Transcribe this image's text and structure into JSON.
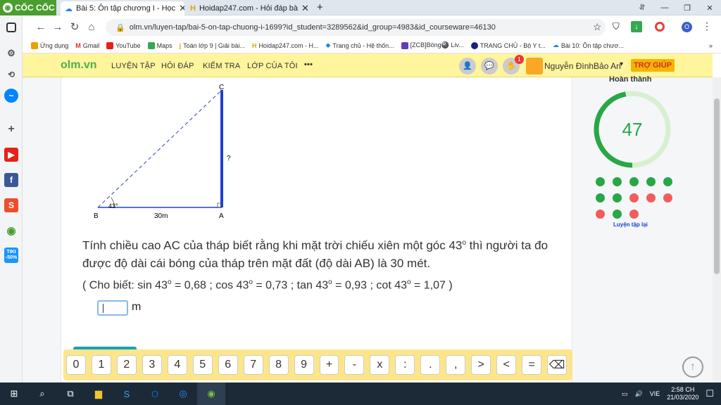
{
  "browser": {
    "brand": "CỐC CỐC",
    "tabs": [
      {
        "title": "Bài 5: Ôn tập chương I - Học",
        "active": true
      },
      {
        "title": "Hoidap247.com - Hỏi đáp bà",
        "active": false
      }
    ],
    "url": "olm.vn/luyen-tap/bai-5-on-tap-chuong-i-1699?id_student=3289562&id_group=4983&id_courseware=46130",
    "bookmarks": [
      "Ứng dụng",
      "Gmail",
      "YouTube",
      "Maps",
      "Toán lớp 9 | Giải bài...",
      "Hoidap247.com - H...",
      "Trang chủ - Hệ thốn...",
      "[ZCB]Bóng🎱 Liv...",
      "TRANG CHỦ - Bộ Y t...",
      "Bài 10: Ôn tập chươ..."
    ]
  },
  "sidebar_badge": "TIKI -50%",
  "olm": {
    "logo": "olm.vn",
    "nav": [
      "LUYỆN TẬP",
      "HỎI ĐÁP",
      "KIỂM TRA",
      "LỚP CỦA TÔI",
      "•••"
    ],
    "notif_count": "1",
    "user": "Nguyễn ĐìnhBảo An",
    "help": "TRỢ GIÚP"
  },
  "figure": {
    "labels": {
      "c": "C",
      "b": "B",
      "a": "A",
      "q": "?",
      "angle": "43°",
      "base": "30m"
    }
  },
  "problem": {
    "line1_pre": "Tính chiều cao AC của tháp biết rằng khi mặt trời chiếu xiên một góc 43",
    "deg": "o",
    "line1_post": " thì người ta đo được độ dài cái bóng của tháp trên mặt đất (độ dài AB) là 30 mét.",
    "hint_open": "( Cho biết: sin 43",
    "hint_1": " = 0,68 ; cos 43",
    "hint_2": " = 0,73 ; tan 43",
    "hint_3": " = 0,93 ; cot 43",
    "hint_close": " = 1,07 )",
    "answer_value": "",
    "unit": "m"
  },
  "progress": {
    "label": "Hoàn thành",
    "score": "47",
    "fraction": 0.47,
    "dots": [
      "green",
      "green",
      "green",
      "green",
      "green",
      "green",
      "green",
      "red",
      "red",
      "red",
      "red",
      "green",
      "red"
    ],
    "retry": "Luyện tập lại"
  },
  "keypad": [
    "0",
    "1",
    "2",
    "3",
    "4",
    "5",
    "6",
    "7",
    "8",
    "9",
    "+",
    "-",
    "x",
    ":",
    ".",
    ",",
    ">",
    "<",
    "=",
    "⌫"
  ],
  "taskbar": {
    "time": "2:58 CH",
    "date": "21/03/2020",
    "lang": "VIE"
  },
  "colors": {
    "green": "#28a745",
    "red": "#f25c5c",
    "blue": "#1e40d0"
  }
}
